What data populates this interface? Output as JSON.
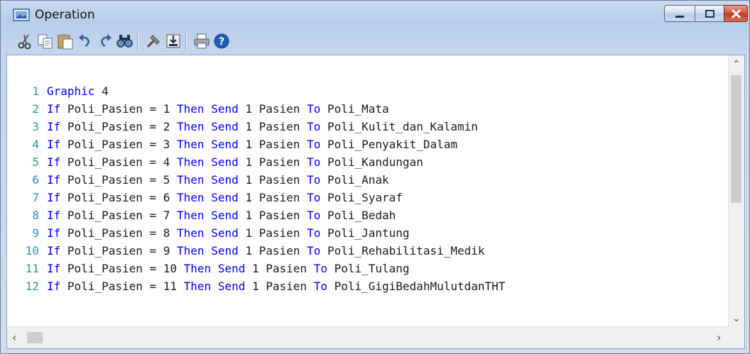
{
  "window": {
    "title": "Operation"
  },
  "toolbar": {
    "buttons": [
      "cut-icon",
      "copy-icon",
      "paste-icon",
      "undo-icon",
      "redo-icon",
      "find-icon",
      "build-icon",
      "save-icon",
      "print-icon",
      "help-icon"
    ]
  },
  "code_lines": [
    {
      "num": "1",
      "tokens": [
        [
          "kw",
          "Graphic"
        ],
        [
          "t",
          " 4"
        ]
      ]
    },
    {
      "num": "2",
      "tokens": [
        [
          "kw",
          "If"
        ],
        [
          "t",
          " Poli_Pasien = 1 "
        ],
        [
          "kw",
          "Then"
        ],
        [
          "t",
          " "
        ],
        [
          "kw",
          "Send"
        ],
        [
          "t",
          " 1 Pasien "
        ],
        [
          "kw",
          "To"
        ],
        [
          "t",
          " Poli_Mata"
        ]
      ]
    },
    {
      "num": "3",
      "tokens": [
        [
          "kw",
          "If"
        ],
        [
          "t",
          " Poli_Pasien = 2 "
        ],
        [
          "kw",
          "Then"
        ],
        [
          "t",
          " "
        ],
        [
          "kw",
          "Send"
        ],
        [
          "t",
          " 1 Pasien "
        ],
        [
          "kw",
          "To"
        ],
        [
          "t",
          " Poli_Kulit_dan_Kalamin"
        ]
      ]
    },
    {
      "num": "4",
      "tokens": [
        [
          "kw",
          "If"
        ],
        [
          "t",
          " Poli_Pasien = 3 "
        ],
        [
          "kw",
          "Then"
        ],
        [
          "t",
          " "
        ],
        [
          "kw",
          "Send"
        ],
        [
          "t",
          " 1 Pasien "
        ],
        [
          "kw",
          "To"
        ],
        [
          "t",
          " Poli_Penyakit_Dalam"
        ]
      ]
    },
    {
      "num": "5",
      "tokens": [
        [
          "kw",
          "If"
        ],
        [
          "t",
          " Poli_Pasien = 4 "
        ],
        [
          "kw",
          "Then"
        ],
        [
          "t",
          " "
        ],
        [
          "kw",
          "Send"
        ],
        [
          "t",
          " 1 Pasien "
        ],
        [
          "kw",
          "To"
        ],
        [
          "t",
          " Poli_Kandungan"
        ]
      ]
    },
    {
      "num": "6",
      "tokens": [
        [
          "kw",
          "If"
        ],
        [
          "t",
          " Poli_Pasien = 5 "
        ],
        [
          "kw",
          "Then"
        ],
        [
          "t",
          " "
        ],
        [
          "kw",
          "Send"
        ],
        [
          "t",
          " 1 Pasien "
        ],
        [
          "kw",
          "To"
        ],
        [
          "t",
          " Poli_Anak"
        ]
      ]
    },
    {
      "num": "7",
      "tokens": [
        [
          "kw",
          "If"
        ],
        [
          "t",
          " Poli_Pasien = 6 "
        ],
        [
          "kw",
          "Then"
        ],
        [
          "t",
          " "
        ],
        [
          "kw",
          "Send"
        ],
        [
          "t",
          " 1 Pasien "
        ],
        [
          "kw",
          "To"
        ],
        [
          "t",
          " Poli_Syaraf"
        ]
      ]
    },
    {
      "num": "8",
      "tokens": [
        [
          "kw",
          "If"
        ],
        [
          "t",
          " Poli_Pasien = 7 "
        ],
        [
          "kw",
          "Then"
        ],
        [
          "t",
          " "
        ],
        [
          "kw",
          "Send"
        ],
        [
          "t",
          " 1 Pasien "
        ],
        [
          "kw",
          "To"
        ],
        [
          "t",
          " Poli_Bedah"
        ]
      ]
    },
    {
      "num": "9",
      "tokens": [
        [
          "kw",
          "If"
        ],
        [
          "t",
          " Poli_Pasien = 8 "
        ],
        [
          "kw",
          "Then"
        ],
        [
          "t",
          " "
        ],
        [
          "kw",
          "Send"
        ],
        [
          "t",
          " 1 Pasien "
        ],
        [
          "kw",
          "To"
        ],
        [
          "t",
          " Poli_Jantung"
        ]
      ]
    },
    {
      "num": "10",
      "tokens": [
        [
          "kw",
          "If"
        ],
        [
          "t",
          " Poli_Pasien = 9 "
        ],
        [
          "kw",
          "Then"
        ],
        [
          "t",
          " "
        ],
        [
          "kw",
          "Send"
        ],
        [
          "t",
          " 1 Pasien "
        ],
        [
          "kw",
          "To"
        ],
        [
          "t",
          " Poli_Rehabilitasi_Medik"
        ]
      ]
    },
    {
      "num": "11",
      "tokens": [
        [
          "kw",
          "If"
        ],
        [
          "t",
          " Poli_Pasien = 10 "
        ],
        [
          "kw",
          "Then"
        ],
        [
          "t",
          " "
        ],
        [
          "kw",
          "Send"
        ],
        [
          "t",
          " 1 Pasien "
        ],
        [
          "kw",
          "To"
        ],
        [
          "t",
          " Poli_Tulang"
        ]
      ]
    },
    {
      "num": "12",
      "tokens": [
        [
          "kw",
          "If"
        ],
        [
          "t",
          " Poli_Pasien = 11 "
        ],
        [
          "kw",
          "Then"
        ],
        [
          "t",
          " "
        ],
        [
          "kw",
          "Send"
        ],
        [
          "t",
          " 1 Pasien "
        ],
        [
          "kw",
          "To"
        ],
        [
          "t",
          " Poli_GigiBedahMulutdanTHT"
        ]
      ]
    }
  ],
  "colors": {
    "keyword": "#0000ff",
    "line_number": "#2b91af",
    "text": "#1a1a1a"
  }
}
